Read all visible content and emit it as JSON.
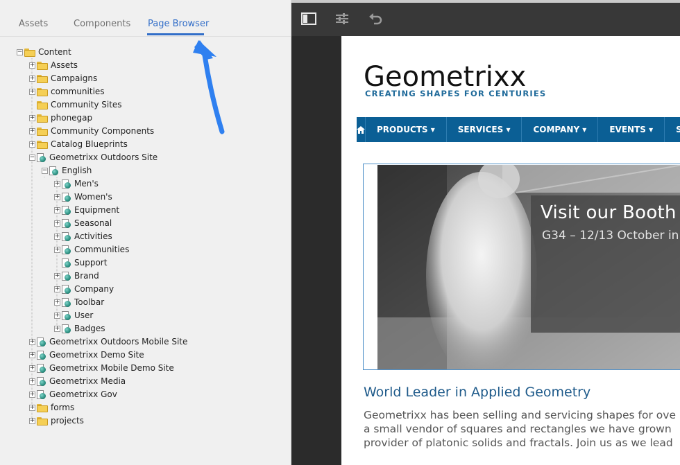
{
  "left_tabs": [
    "Assets",
    "Components",
    "Page Browser"
  ],
  "active_tab": "Page Browser",
  "tree": [
    {
      "label": "Content",
      "icon": "folder-icon",
      "expander": "minus"
    },
    {
      "label": "Assets",
      "icon": "folder-icon",
      "expander": "plus"
    },
    {
      "label": "Campaigns",
      "icon": "folder-icon",
      "expander": "plus"
    },
    {
      "label": "communities",
      "icon": "folder-icon",
      "expander": "plus"
    },
    {
      "label": "Community Sites",
      "icon": "folder-icon",
      "expander": "none"
    },
    {
      "label": "phonegap",
      "icon": "folder-icon",
      "expander": "plus"
    },
    {
      "label": "Community Components",
      "icon": "folder-icon",
      "expander": "plus"
    },
    {
      "label": "Catalog Blueprints",
      "icon": "folder-icon",
      "expander": "plus"
    },
    {
      "label": "Geometrixx Outdoors Site",
      "icon": "page-icon",
      "expander": "minus"
    },
    {
      "label": "English",
      "icon": "page-icon",
      "expander": "minus"
    },
    {
      "label": "Men's",
      "icon": "page-icon",
      "expander": "plus"
    },
    {
      "label": "Women's",
      "icon": "page-icon",
      "expander": "plus"
    },
    {
      "label": "Equipment",
      "icon": "page-icon",
      "expander": "plus"
    },
    {
      "label": "Seasonal",
      "icon": "page-icon",
      "expander": "plus"
    },
    {
      "label": "Activities",
      "icon": "page-icon",
      "expander": "plus"
    },
    {
      "label": "Communities",
      "icon": "page-icon",
      "expander": "plus"
    },
    {
      "label": "Support",
      "icon": "page-icon",
      "expander": "none"
    },
    {
      "label": "Brand",
      "icon": "page-icon",
      "expander": "plus"
    },
    {
      "label": "Company",
      "icon": "page-icon",
      "expander": "plus"
    },
    {
      "label": "Toolbar",
      "icon": "page-icon",
      "expander": "plus"
    },
    {
      "label": "User",
      "icon": "page-icon",
      "expander": "plus"
    },
    {
      "label": "Badges",
      "icon": "page-icon",
      "expander": "plus"
    },
    {
      "label": "Geometrixx Outdoors Mobile Site",
      "icon": "page-icon",
      "expander": "plus"
    },
    {
      "label": "Geometrixx Demo Site",
      "icon": "page-icon",
      "expander": "plus"
    },
    {
      "label": "Geometrixx Mobile Demo Site",
      "icon": "page-icon",
      "expander": "plus"
    },
    {
      "label": "Geometrixx Media",
      "icon": "page-icon",
      "expander": "plus"
    },
    {
      "label": "Geometrixx Gov",
      "icon": "page-icon",
      "expander": "plus"
    },
    {
      "label": "forms",
      "icon": "folder-icon",
      "expander": "plus"
    },
    {
      "label": "projects",
      "icon": "folder-icon",
      "expander": "plus"
    }
  ],
  "toolbar_icons": [
    "sidepanel-toggle-icon",
    "page-properties-icon",
    "undo-icon"
  ],
  "site": {
    "logo": "Geometrixx",
    "tagline": "CREATING SHAPES FOR CENTURIES",
    "nav": [
      {
        "label": "PRODUCTS ▾"
      },
      {
        "label": "SERVICES ▾"
      },
      {
        "label": "COMPANY ▾"
      },
      {
        "label": "EVENTS ▾"
      },
      {
        "label": "SU"
      }
    ],
    "hero_title": "Visit our Booth",
    "hero_subtitle": "G34 – 12/13 October in",
    "article_title": "World Leader in Applied Geometry",
    "article_lines": [
      "Geometrixx has been selling and servicing shapes for ove",
      "a small vendor of squares and rectangles we have grown",
      "provider of platonic solids and fractals. Join us as we lead"
    ]
  },
  "colors": {
    "accent": "#326ec8",
    "nav_bg": "#0b5f95",
    "toolbar_bg": "#383838",
    "panel_bg": "#f0f0f0",
    "arrow": "#2f80f0"
  }
}
